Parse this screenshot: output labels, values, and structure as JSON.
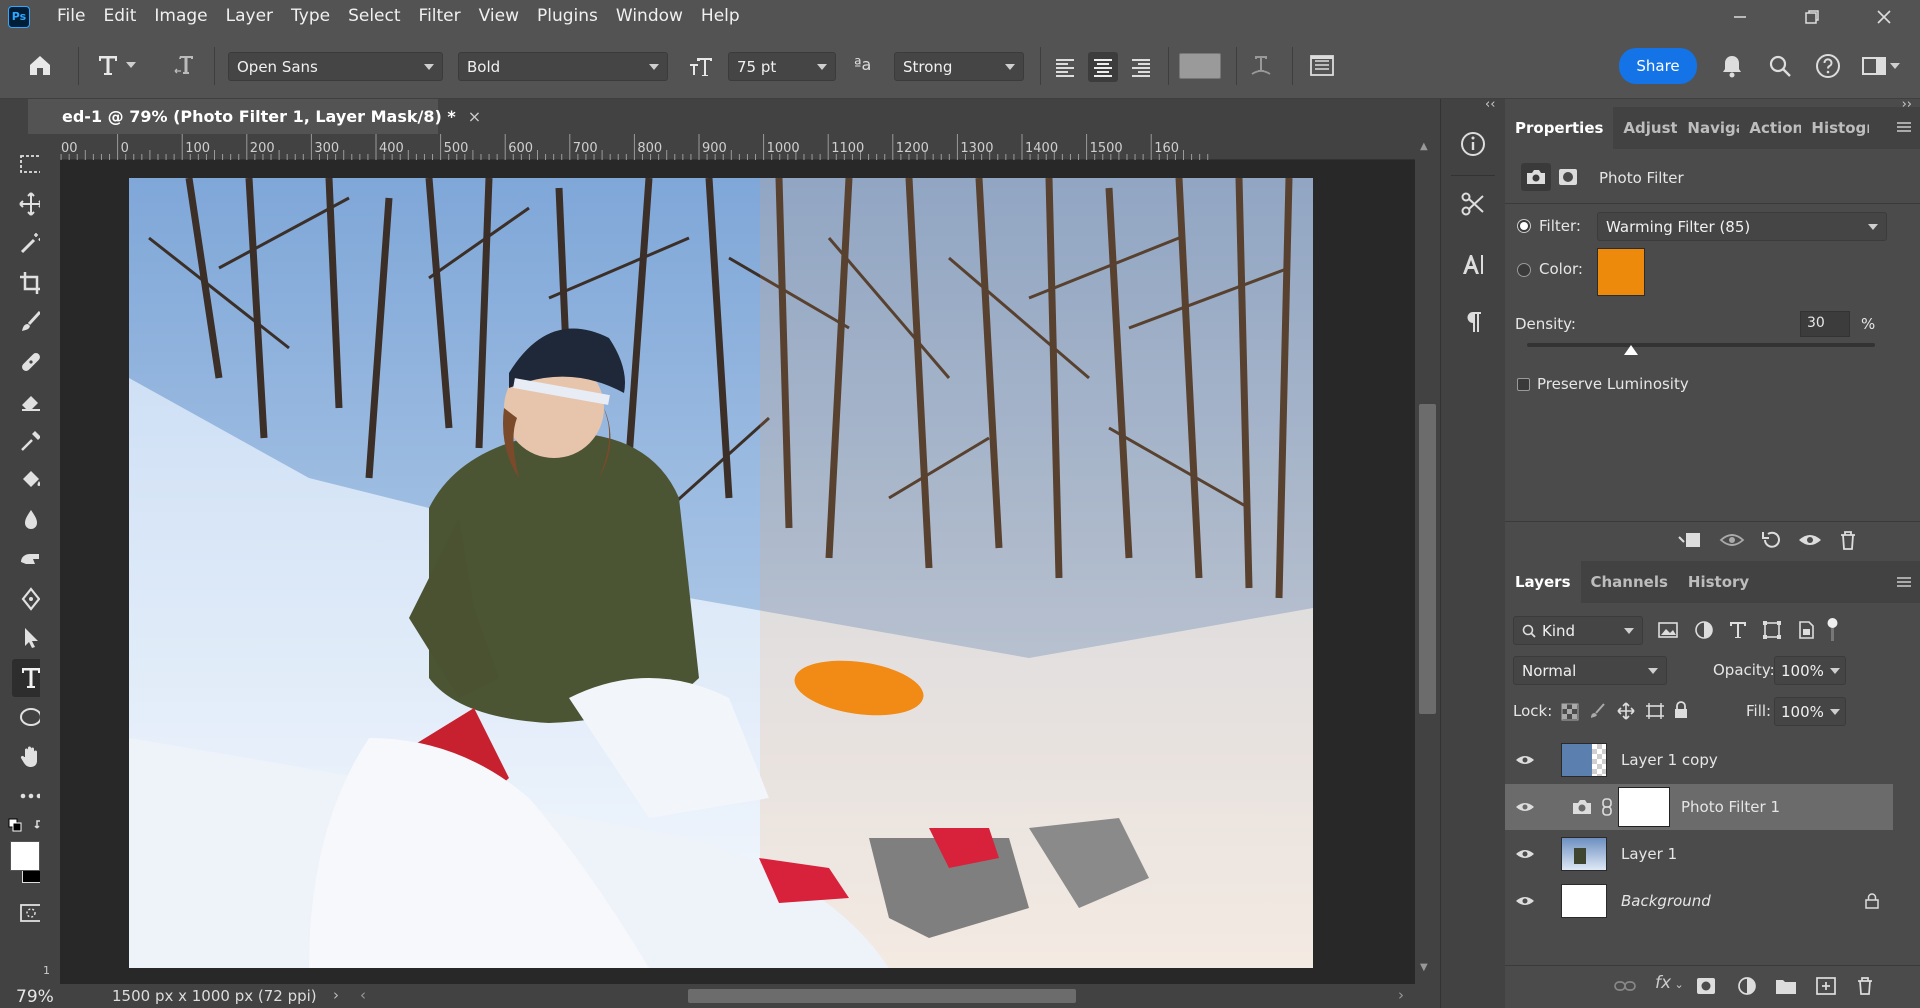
{
  "app": {
    "logo": "Ps"
  },
  "menu": [
    "File",
    "Edit",
    "Image",
    "Layer",
    "Type",
    "Select",
    "Filter",
    "View",
    "Plugins",
    "Window",
    "Help"
  ],
  "options": {
    "font_family": "Open Sans",
    "font_style": "Bold",
    "font_size": "75 pt",
    "aa_label": "ªa",
    "antialias": "Strong",
    "share_label": "Share"
  },
  "document": {
    "tab_title": "ed-1 @ 79% (Photo Filter 1, Layer Mask/8) *",
    "zoom": "79%",
    "info": "1500 px x 1000 px (72 ppi)",
    "ruler_ticks": [
      "00",
      "0",
      "100",
      "200",
      "300",
      "400",
      "500",
      "600",
      "700",
      "800",
      "900",
      "1000",
      "1100",
      "1200",
      "1300",
      "1400",
      "1500",
      "160"
    ],
    "vruler_label": "1"
  },
  "properties": {
    "tabs": [
      "Properties",
      "Adjustı",
      "Naviga",
      "Action:",
      "Histogr"
    ],
    "type_title": "Photo Filter",
    "filter_label": "Filter:",
    "filter_value": "Warming Filter (85)",
    "color_label": "Color:",
    "color_swatch": "#ee8a0b",
    "density_label": "Density:",
    "density_value": "30",
    "density_unit": "%",
    "density_fraction": 0.3,
    "preserve_label": "Preserve Luminosity"
  },
  "layers_panel": {
    "tabs": [
      "Layers",
      "Channels",
      "History"
    ],
    "filter_kind": "Kind",
    "blend_mode": "Normal",
    "opacity_label": "Opacity:",
    "opacity_value": "100%",
    "lock_label": "Lock:",
    "fill_label": "Fill:",
    "fill_value": "100%",
    "layers": [
      {
        "name": "Layer 1 copy"
      },
      {
        "name": "Photo Filter 1"
      },
      {
        "name": "Layer 1"
      },
      {
        "name": "Background"
      }
    ]
  },
  "icons": [
    "home-icon",
    "type-tool-icon",
    "text-orientation-icon",
    "font-size-icon",
    "align-left-icon",
    "align-center-icon",
    "align-right-icon",
    "text-color-swatch",
    "warp-text-icon",
    "character-panel-icon",
    "bell-icon",
    "search-icon",
    "help-icon",
    "workspace-icon"
  ]
}
